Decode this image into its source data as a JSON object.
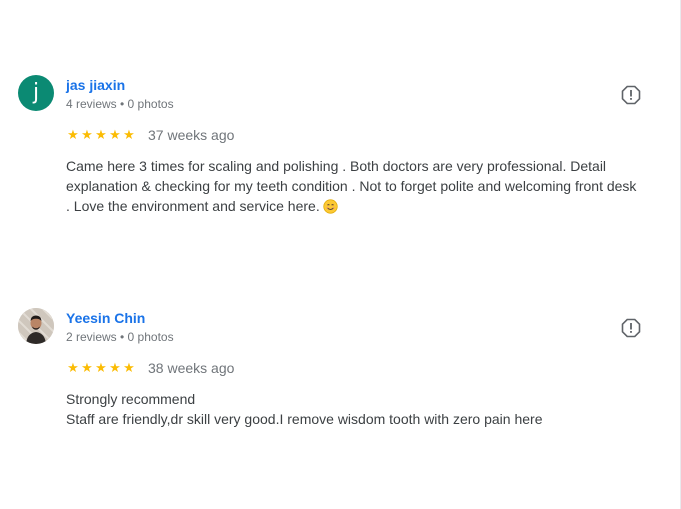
{
  "reviews": [
    {
      "avatar_letter": "j",
      "avatar_color": "#0b8a73",
      "author": "jas jiaxin",
      "meta": "4 reviews • 0 photos",
      "stars": [
        "★",
        "★",
        "★",
        "★",
        "★"
      ],
      "rating": 5,
      "time": "37 weeks ago",
      "text": "Came here 3 times for scaling and polishing . Both doctors are very professional. Detail explanation & checking for my teeth condition . Not to forget polite and welcoming front desk . Love the environment and service here.",
      "emoji": "smiling-face-icon"
    },
    {
      "avatar_letter": "",
      "author": "Yeesin Chin",
      "meta": "2 reviews • 0 photos",
      "stars": [
        "★",
        "★",
        "★",
        "★",
        "★"
      ],
      "rating": 5,
      "time": "38 weeks ago",
      "text_lines": [
        "Strongly recommend",
        "Staff are friendly,dr skill very good.I remove wisdom tooth with zero pain here"
      ]
    }
  ],
  "colors": {
    "author": "#1a73e8",
    "star": "#fbbc04",
    "meta": "#70757a"
  }
}
